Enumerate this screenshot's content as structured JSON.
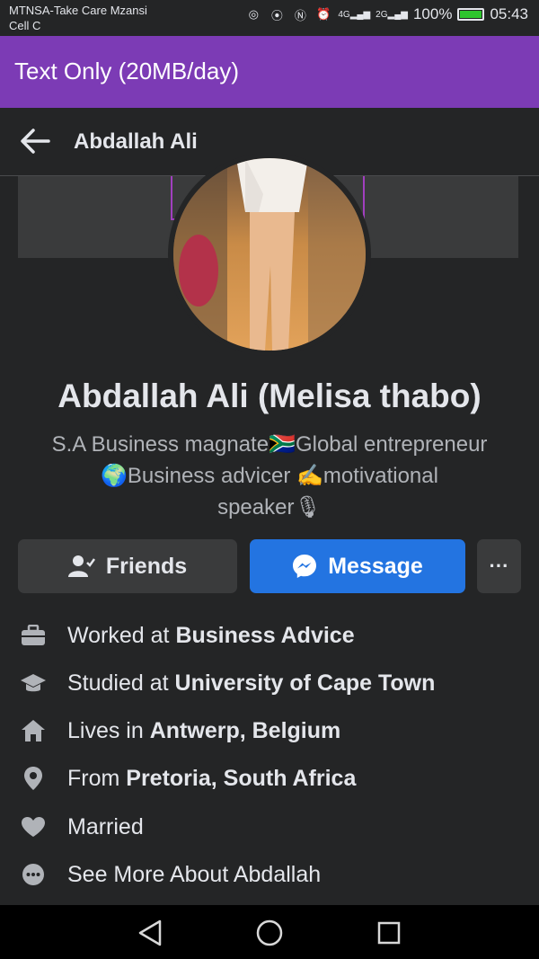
{
  "status_bar": {
    "carrier_line1": "MTNSA-Take Care Mzansi",
    "carrier_line2": "Cell C",
    "network_labels": [
      "4G",
      "2G"
    ],
    "battery": "100%",
    "time": "05:43"
  },
  "banner": {
    "text": "Text Only (20MB/day)"
  },
  "appbar": {
    "title": "Abdallah Ali"
  },
  "profile": {
    "name": "Abdallah Ali (Melisa thabo)",
    "bio_line1": "S.A Business magnate🇿🇦Global entrepreneur",
    "bio_line2": "🌍Business advicer ✍motivational",
    "bio_line3": "speaker🎙"
  },
  "buttons": {
    "friends": "Friends",
    "message": "Message",
    "more": "···"
  },
  "info": [
    {
      "icon": "briefcase-icon",
      "prefix": "Worked at ",
      "value": "Business Advice"
    },
    {
      "icon": "graduation-cap-icon",
      "prefix": "Studied at ",
      "value": "University of Cape Town"
    },
    {
      "icon": "home-icon",
      "prefix": "Lives in ",
      "value": "Antwerp, Belgium"
    },
    {
      "icon": "location-pin-icon",
      "prefix": "From ",
      "value": "Pretoria, South Africa"
    },
    {
      "icon": "heart-icon",
      "prefix": "",
      "value": "Married"
    },
    {
      "icon": "more-dots-icon",
      "prefix": "See More About Abdallah",
      "value": ""
    }
  ],
  "colors": {
    "accent": "#2374e1",
    "banner": "#7c3bb5",
    "background": "#242526"
  }
}
